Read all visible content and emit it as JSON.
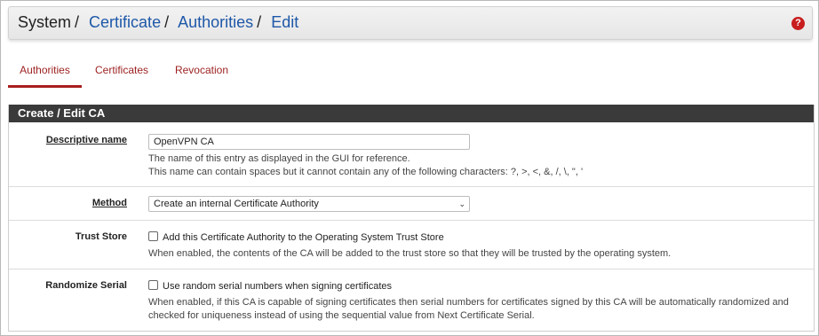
{
  "breadcrumb": {
    "root": "System",
    "items": [
      "Certificate",
      "Authorities",
      "Edit"
    ],
    "separator": "/"
  },
  "help_icon_glyph": "?",
  "tabs": [
    {
      "label": "Authorities",
      "active": true
    },
    {
      "label": "Certificates",
      "active": false
    },
    {
      "label": "Revocation",
      "active": false
    }
  ],
  "panel": {
    "title": "Create / Edit CA",
    "fields": {
      "descriptive_name": {
        "label": "Descriptive name",
        "value": "OpenVPN CA",
        "help1": "The name of this entry as displayed in the GUI for reference.",
        "help2": "This name can contain spaces but it cannot contain any of the following characters: ?, >, <, &, /, \\, \", '"
      },
      "method": {
        "label": "Method",
        "value": "Create an internal Certificate Authority"
      },
      "trust_store": {
        "label": "Trust Store",
        "checkbox_label": "Add this Certificate Authority to the Operating System Trust Store",
        "checked": false,
        "help": "When enabled, the contents of the CA will be added to the trust store so that they will be trusted by the operating system."
      },
      "randomize_serial": {
        "label": "Randomize Serial",
        "checkbox_label": "Use random serial numbers when signing certificates",
        "checked": false,
        "help1": "When enabled, if this CA is capable of signing certificates then serial numbers for certificates signed by this CA will be automatically randomized and",
        "help2": "checked for uniqueness instead of using the sequential value from Next Certificate Serial."
      }
    }
  },
  "colors": {
    "accent_red": "#a81e1e",
    "link_blue": "#1e58a8",
    "heading_bg": "#3a3a3a"
  }
}
